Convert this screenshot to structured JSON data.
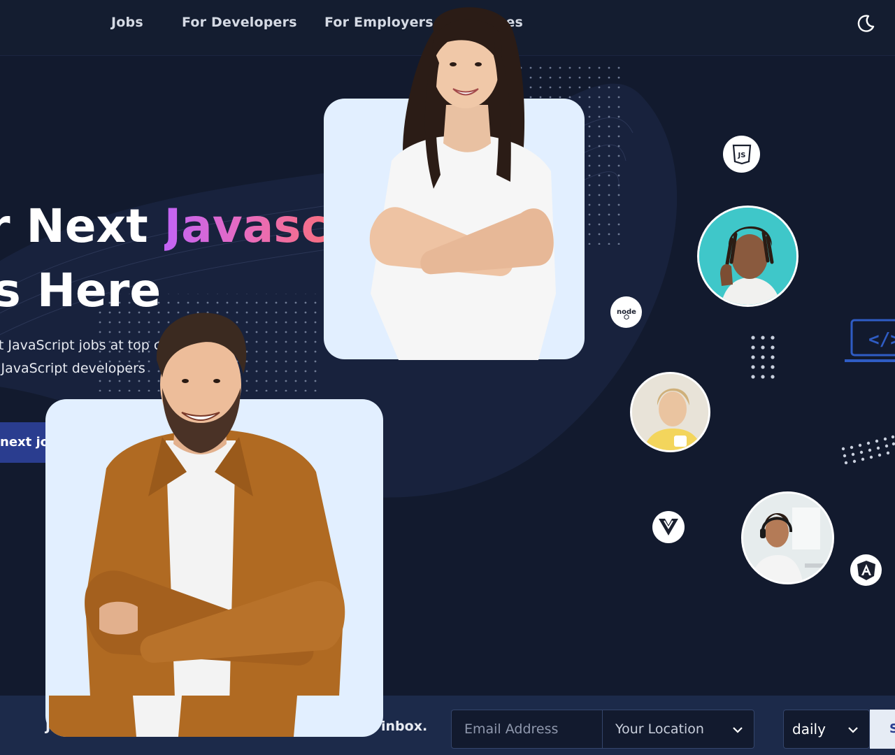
{
  "nav": {
    "links": [
      "Jobs",
      "For Developers",
      "For Employers",
      "Resources"
    ],
    "theme_icon": "moon-icon"
  },
  "hero": {
    "headline_line1_plain": "r Next ",
    "headline_line1_accent": "Javasc",
    "headline_line2": " Is Here",
    "sub_line1": "st JavaScript jobs at top companies",
    "sub_line2": "t JavaScript developers",
    "cta_label": "next jobs",
    "accent_colors": [
      "#c264f5",
      "#e86bbd",
      "#f76f7f"
    ]
  },
  "tech_badges": [
    "js-icon",
    "node-icon",
    "vue-icon",
    "angular-icon",
    "code-laptop-icon"
  ],
  "newsletter": {
    "text_left": "Jo",
    "text_right": "inbox.",
    "email_placeholder": "Email Address",
    "location_placeholder": "Your Location",
    "frequency_value": "daily",
    "submit_label": "Subscribe"
  },
  "colors": {
    "background": "#121a2e",
    "nav": "#141d30",
    "card": "#e2efff",
    "cta": "#2a3d8f",
    "footer": "#1c2a4a"
  }
}
